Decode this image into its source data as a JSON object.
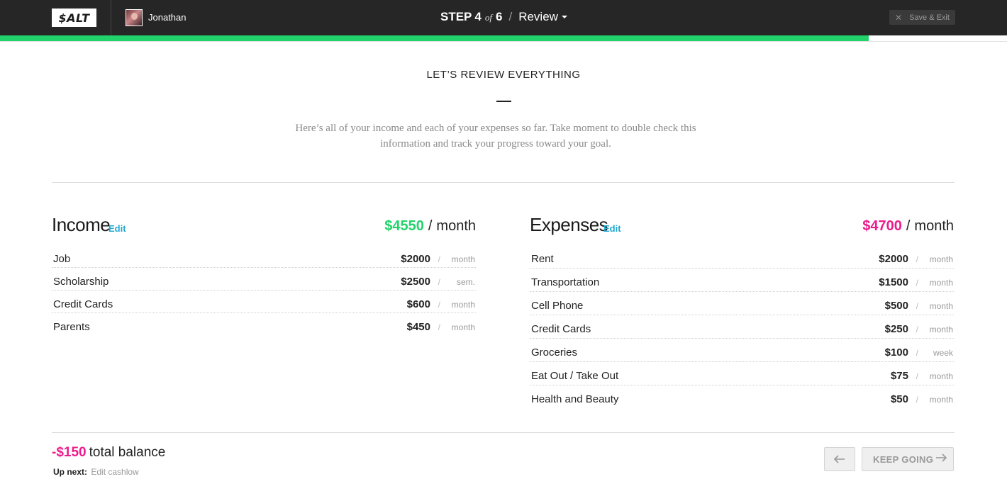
{
  "header": {
    "logo_text": "$ALT",
    "user_name": "Jonathan",
    "step_label": "STEP",
    "step_current": "4",
    "step_of": "of",
    "step_total": "6",
    "step_separator": "/",
    "section_name": "Review",
    "save_exit_label": "Save & Exit",
    "progress": 0.863
  },
  "intro": {
    "heading": "LET’S REVIEW EVERYTHING",
    "body": "Here’s all of your income and each of your expenses so far. Take moment to double check this information and track your progress toward your goal."
  },
  "income": {
    "title": "Income",
    "edit_label": "Edit",
    "total": "$4550",
    "separator": "/",
    "total_period": "month",
    "items": [
      {
        "label": "Job",
        "value": "$2000",
        "slash": "/",
        "period": "month"
      },
      {
        "label": "Scholarship",
        "value": "$2500",
        "slash": "/",
        "period": "sem."
      },
      {
        "label": "Credit Cards",
        "value": "$600",
        "slash": "/",
        "period": "month"
      },
      {
        "label": "Parents",
        "value": "$450",
        "slash": "/",
        "period": "month"
      }
    ]
  },
  "expenses": {
    "title": "Expenses",
    "edit_label": "Edit",
    "total": "$4700",
    "separator": "/",
    "total_period": "month",
    "items": [
      {
        "label": "Rent",
        "value": "$2000",
        "slash": "/",
        "period": "month"
      },
      {
        "label": "Transportation",
        "value": "$1500",
        "slash": "/",
        "period": "month"
      },
      {
        "label": "Cell Phone",
        "value": "$500",
        "slash": "/",
        "period": "month"
      },
      {
        "label": "Credit Cards",
        "value": "$250",
        "slash": "/",
        "period": "month"
      },
      {
        "label": "Groceries",
        "value": "$100",
        "slash": "/",
        "period": "week"
      },
      {
        "label": "Eat Out / Take Out",
        "value": "$75",
        "slash": "/",
        "period": "month"
      },
      {
        "label": "Health and Beauty",
        "value": "$50",
        "slash": "/",
        "period": "month"
      }
    ]
  },
  "footer": {
    "balance_amount": "-$150",
    "balance_label": "total balance",
    "up_next_label": "Up next:",
    "up_next_value": "Edit cashlow",
    "keep_going_label": "KEEP GOING"
  },
  "colors": {
    "accent_green": "#21d36a",
    "accent_pink": "#ec1b8c",
    "link_blue": "#22a7d0",
    "topbar_bg": "#262626"
  },
  "icons": {
    "close": "close-icon",
    "caret": "chevron-down-icon",
    "back": "arrow-left-icon",
    "forward": "arrow-right-icon"
  }
}
